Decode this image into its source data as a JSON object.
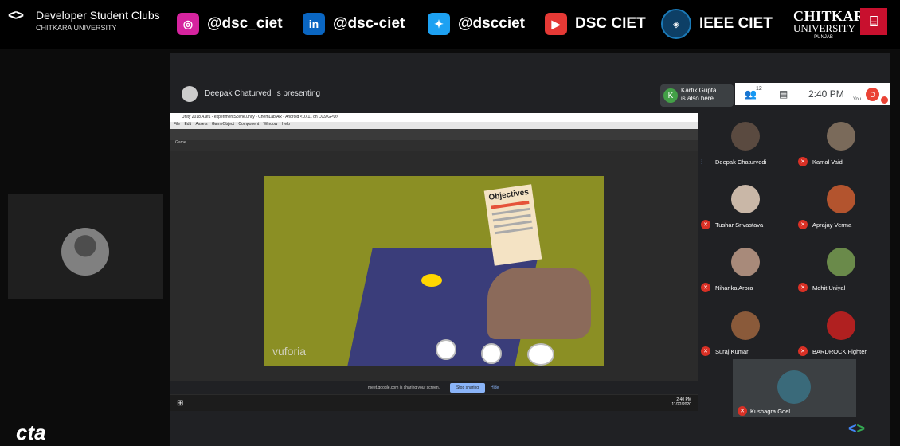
{
  "banner": {
    "dsc_logo": "<>",
    "dsc_title": "Developer Student Clubs",
    "dsc_subtitle": "CHITKARA UNIVERSITY",
    "instagram": "@dsc_ciet",
    "linkedin": "@dsc-ciet",
    "twitter": "@dscciet",
    "youtube": "DSC CIET",
    "ieee": "IEEE CIET",
    "chitkara_line1": "CHITKARA",
    "chitkara_line2": "UNIVERSITY",
    "chitkara_line3": "PUNJAB"
  },
  "meet": {
    "presenter_text": "Deepak Chaturvedi is presenting",
    "also_here_name": "Kartik Gupta",
    "also_here_suffix": "is also here",
    "participants_count": "12",
    "time": "2:40 PM",
    "you_label": "You",
    "self_initial": "D"
  },
  "screen": {
    "unity_title": "Unity 2018.4.9f1 - experimentScene.unity - ChemLab AR - Android <DX11 on DX9 GPU>",
    "menu": [
      "File",
      "Edit",
      "Assets",
      "GameObject",
      "Component",
      "Window",
      "Help"
    ],
    "game_tab": "Game",
    "objectives_heading": "Objectives",
    "brand": "vuforia",
    "share_message": "meet.google.com is sharing your screen.",
    "stop_sharing": "Stop sharing",
    "hide": "Hide",
    "clock_time": "2:40 PM",
    "clock_date": "11/22/2020",
    "lang": "ENG IN"
  },
  "participants": [
    {
      "name": "Deepak Chaturvedi",
      "speaking": true
    },
    {
      "name": "Kamal Vaid",
      "speaking": false
    },
    {
      "name": "Tushar Srivastava",
      "speaking": false
    },
    {
      "name": "Aprajay Verma",
      "speaking": false
    },
    {
      "name": "Niharika Arora",
      "speaking": false
    },
    {
      "name": "Mohit Uniyal",
      "speaking": false
    },
    {
      "name": "Suraj Kumar",
      "speaking": false
    },
    {
      "name": "BARDROCK Fighter",
      "speaking": false
    },
    {
      "name": "Kushagra Goel",
      "speaking": false
    }
  ],
  "footer": {
    "cta_text": "cta"
  },
  "colors": {
    "instagram": "#d6249f",
    "linkedin": "#0a66c2",
    "twitter": "#1da1f2",
    "youtube": "#e53935",
    "mic_off": "#d93025",
    "stop_sharing": "#8ab4f8"
  }
}
